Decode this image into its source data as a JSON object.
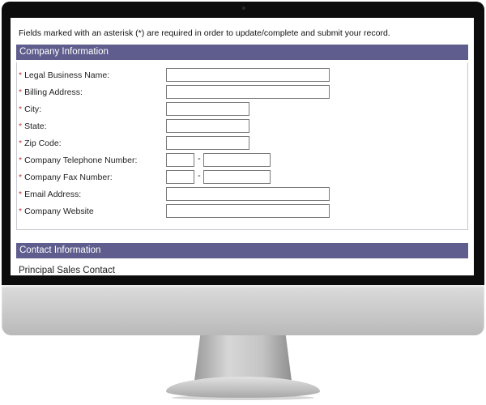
{
  "intro_text": "Fields marked with an asterisk (*) are required in order to update/complete and submit your record.",
  "company_section": {
    "title": "Company Information",
    "fields": [
      {
        "label": "Legal Business Name:",
        "value": ""
      },
      {
        "label": "Billing Address:",
        "value": ""
      },
      {
        "label": "City:",
        "value": ""
      },
      {
        "label": "State:",
        "value": ""
      },
      {
        "label": "Zip Code:",
        "value": ""
      },
      {
        "label": "Company Telephone Number:",
        "value_area": "",
        "value_number": ""
      },
      {
        "label": "Company Fax Number:",
        "value_area": "",
        "value_number": ""
      },
      {
        "label": "Email Address:",
        "value": ""
      },
      {
        "label": "Company Website",
        "value": ""
      }
    ],
    "required_marker": "*",
    "phone_separator": "-"
  },
  "contact_section": {
    "title": "Contact Information",
    "sub_heading": "Principal Sales Contact"
  },
  "colors": {
    "section_header_bg": "#5f5d8d",
    "required_marker": "#c0392b"
  }
}
